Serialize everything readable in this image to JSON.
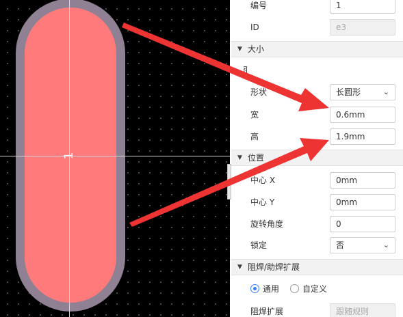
{
  "canvas": {
    "pad_number": "1",
    "colors": {
      "background": "#000000",
      "pad_fill": "#ff7b7b",
      "pad_outline": "#8f8193",
      "crosshair": "#d8d8d8",
      "arrow": "#ee3333"
    }
  },
  "panel": {
    "props_top": [
      {
        "label": "编号",
        "value": "1",
        "disabled": false
      },
      {
        "label": "ID",
        "value": "e3",
        "disabled": true
      }
    ],
    "size_section": {
      "title": "大小",
      "cut_label": "图",
      "rows": [
        {
          "label": "形状",
          "value": "长圆形",
          "type": "select"
        },
        {
          "label": "宽",
          "value": "0.6mm",
          "type": "input"
        },
        {
          "label": "高",
          "value": "1.9mm",
          "type": "input"
        }
      ]
    },
    "position_section": {
      "title": "位置",
      "rows": [
        {
          "label": "中心 X",
          "value": "0mm",
          "type": "input"
        },
        {
          "label": "中心 Y",
          "value": "0mm",
          "type": "input"
        },
        {
          "label": "旋转角度",
          "value": "0",
          "type": "input"
        },
        {
          "label": "锁定",
          "value": "否",
          "type": "select"
        }
      ]
    },
    "solder_section": {
      "title": "阻焊/助焊扩展",
      "radio_options": [
        {
          "label": "通用",
          "checked": true
        },
        {
          "label": "自定义",
          "checked": false
        }
      ],
      "rows": [
        {
          "label": "阻焊扩展",
          "value": "跟随规则",
          "disabled": true
        }
      ]
    },
    "caret_icon": "chevron-down-icon",
    "collapse_icon": "triangle-down-icon"
  }
}
